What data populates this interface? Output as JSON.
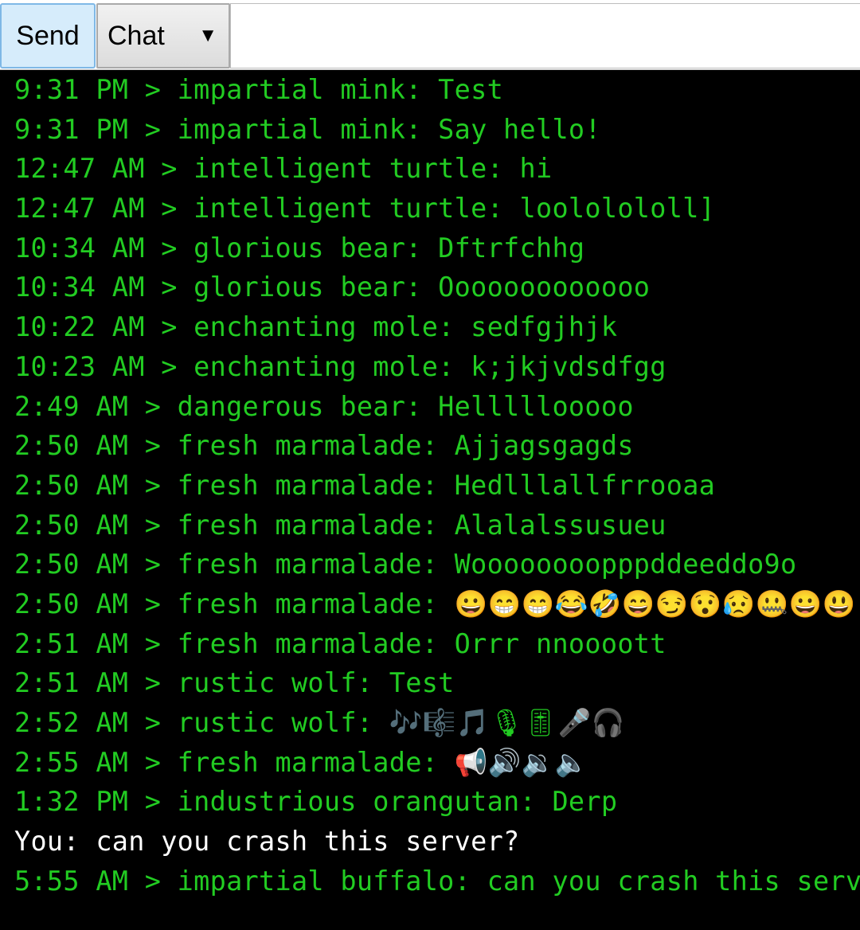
{
  "toolbar": {
    "send_label": "Send",
    "mode_selected": "Chat",
    "mode_arrow": "▼",
    "message_value": "",
    "message_placeholder": ""
  },
  "colors": {
    "others": "#22cc22",
    "self": "#ffffff",
    "background": "#000000"
  },
  "messages": [
    {
      "text": "9:31 PM > impartial mink: Test",
      "self": false
    },
    {
      "text": "9:31 PM > impartial mink: Say hello!",
      "self": false
    },
    {
      "text": "12:47 AM > intelligent turtle: hi",
      "self": false
    },
    {
      "text": "12:47 AM > intelligent turtle: loololololl]",
      "self": false
    },
    {
      "text": "10:34 AM > glorious bear: Dftrfchhg",
      "self": false
    },
    {
      "text": "10:34 AM > glorious bear: Ooooooooooooo",
      "self": false
    },
    {
      "text": "10:22 AM > enchanting mole: sedfgjhjk",
      "self": false
    },
    {
      "text": "10:23 AM > enchanting mole: k;jkjvdsdfgg",
      "self": false
    },
    {
      "text": "2:49 AM > dangerous bear: Helllllooooo",
      "self": false
    },
    {
      "text": "2:50 AM > fresh marmalade: Ajjagsgagds",
      "self": false
    },
    {
      "text": "2:50 AM > fresh marmalade: Hedlllallfrrooaa",
      "self": false
    },
    {
      "text": "2:50 AM > fresh marmalade: Alalalssusueu",
      "self": false
    },
    {
      "text": "2:50 AM > fresh marmalade: Woooooooopppddeeddo9o",
      "self": false
    },
    {
      "text": "2:50 AM > fresh marmalade: 😀😁😁😂🤣😄😏😯😥🤐😀😃",
      "self": false
    },
    {
      "text": "2:51 AM > fresh marmalade: Orrr nnoooott",
      "self": false
    },
    {
      "text": "2:51 AM > rustic wolf: Test",
      "self": false
    },
    {
      "text": "2:52 AM > rustic wolf: 🎶🎼🎵🎙🎚🎤🎧",
      "self": false
    },
    {
      "text": "2:55 AM > fresh marmalade: 📢🔊🔉🔈",
      "self": false
    },
    {
      "text": "1:32 PM > industrious orangutan: Derp",
      "self": false
    },
    {
      "text": "You: can you crash this server?",
      "self": true
    },
    {
      "text": "5:55 AM > impartial buffalo: can you crash this serv",
      "self": false
    }
  ]
}
